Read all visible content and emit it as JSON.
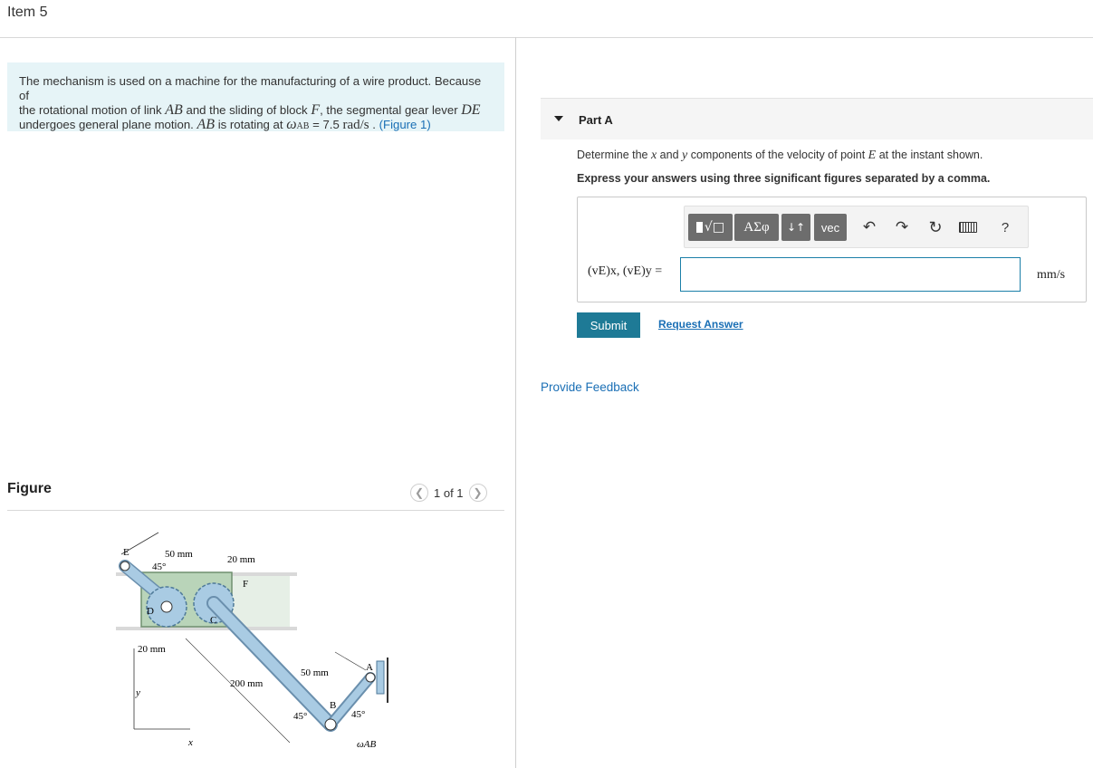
{
  "item": {
    "title": "Item 5"
  },
  "problem": {
    "line1_a": "The mechanism is used on a machine for the manufacturing of a wire product. Because of",
    "line2_a": "the rotational motion of link ",
    "link_ab": "AB",
    "line2_b": " and the sliding of block ",
    "block_f": "F",
    "line2_c": ", the segmental gear lever ",
    "lever_de": "DE",
    "line3_a": "undergoes general plane motion. ",
    "line3_ab": "AB",
    "line3_b": " is rotating at ",
    "omega": "ω",
    "omega_sub": "AB",
    "line3_c": " = 7.5 ",
    "units": "rad/s",
    "line3_d": " . ",
    "figure_link": "(Figure 1)"
  },
  "figure": {
    "label": "Figure",
    "pager": "1 of 1",
    "labels": {
      "e": "E",
      "dim50top": "50 mm",
      "ang45top": "45°",
      "dim20top": "20 mm",
      "f": "F",
      "d": "D",
      "c": "C",
      "dim20left": "20 mm",
      "dim50right": "50 mm",
      "a": "A",
      "dim200": "200 mm",
      "b": "B",
      "ang45left": "45°",
      "ang45right": "45°",
      "y": "y",
      "x": "x",
      "omega_ab": "ωAB"
    }
  },
  "part_a": {
    "label": "Part A",
    "question_a": "Determine the ",
    "var_x": "x",
    "question_b": " and ",
    "var_y": "y",
    "question_c": " components of the velocity of point ",
    "point_e": "E",
    "question_d": " at the instant shown.",
    "instruction": "Express your answers using three significant figures separated by a comma.",
    "toolbar": {
      "greek": "ΑΣφ",
      "updown": "↓↑",
      "vec": "vec",
      "help": "?"
    },
    "equation_label": "(vE)x, (vE)y =",
    "input_value": "",
    "unit": "mm/s",
    "submit": "Submit",
    "request_answer": "Request Answer"
  },
  "feedback": {
    "label": "Provide Feedback"
  },
  "colors": {
    "accent": "#1e7a96",
    "link": "#1a6fb5",
    "problem_bg": "#e6f4f7",
    "gear": "#a9cbe3"
  }
}
